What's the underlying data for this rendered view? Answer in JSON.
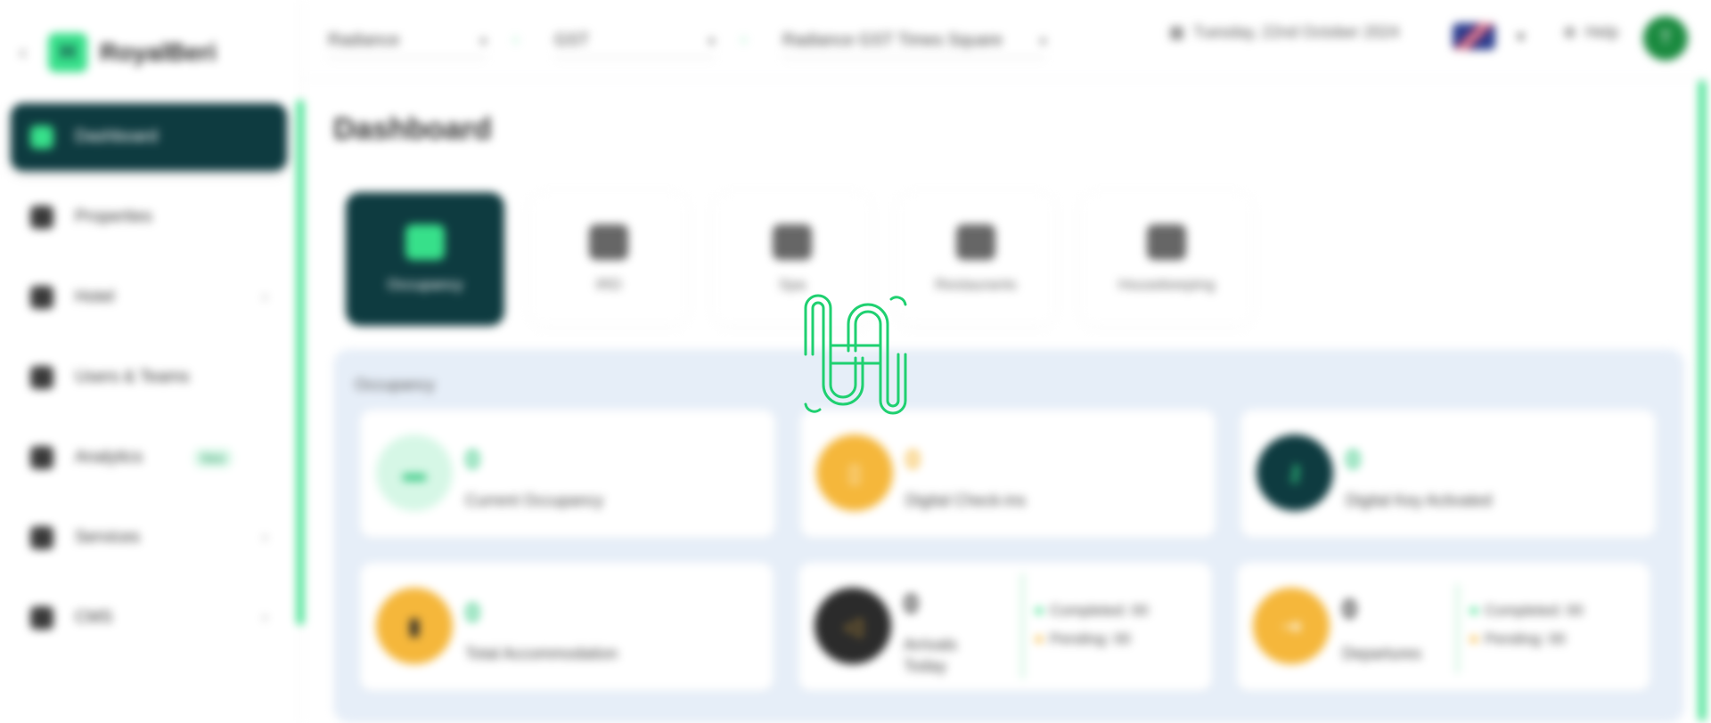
{
  "brand": {
    "name": "RoyalBeri"
  },
  "sidebar": {
    "items": [
      {
        "label": "Dashboard",
        "active": true,
        "icon": "grid-icon"
      },
      {
        "label": "Properties",
        "icon": "home-icon"
      },
      {
        "label": "Hotel",
        "icon": "hotel-icon",
        "has_chevron": true
      },
      {
        "label": "Users & Teams",
        "icon": "user-icon"
      },
      {
        "label": "Analytics",
        "icon": "chart-icon",
        "badge": "New"
      },
      {
        "label": "Services",
        "icon": "services-icon",
        "has_chevron": true
      },
      {
        "label": "CMS",
        "icon": "folder-icon",
        "has_chevron": true
      }
    ]
  },
  "header": {
    "property_select": "Radiance",
    "timezone_select": "GST",
    "hotel_select": "Radiance GST Times Square",
    "date": "Tuesday, 22nd October 2024",
    "help_label": "Help",
    "avatar_initial": "T"
  },
  "page": {
    "title": "Dashboard"
  },
  "tabs": [
    {
      "label": "Occupancy",
      "active": true,
      "icon": "bed-icon"
    },
    {
      "label": "IRD",
      "icon": "cutlery-icon"
    },
    {
      "label": "Spa",
      "icon": "spa-icon"
    },
    {
      "label": "Restaurants",
      "icon": "restaurant-icon"
    },
    {
      "label": "Housekeeping",
      "icon": "housekeeping-icon"
    }
  ],
  "panel": {
    "title": "Occupancy",
    "cards": [
      {
        "value": "0",
        "label": "Current Occupancy",
        "icon": "bed-icon",
        "icon_bg": "#d6f7e6",
        "value_color": "#37c983"
      },
      {
        "value": "0",
        "label": "Digital Check-ins",
        "icon": "phone-icon",
        "icon_bg": "#f5b73b",
        "value_color": "#f5b73b"
      },
      {
        "value": "0",
        "label": "Digital Key Activated",
        "icon": "key-icon",
        "icon_bg": "#0e3b40",
        "value_color": "#37c983"
      },
      {
        "value": "0",
        "label": "Total Accommodation",
        "icon": "door-icon",
        "icon_bg": "#f5b73b",
        "value_color": "#37c983"
      },
      {
        "value": "0",
        "label": "Arrivals Today",
        "icon": "arrival-icon",
        "icon_bg": "#2b2b2b",
        "value_color": "#2b2b2b",
        "completed": "Completed: 00",
        "pending": "Pending: 00"
      },
      {
        "value": "0",
        "label": "Departures",
        "icon": "departure-icon",
        "icon_bg": "#f5b73b",
        "value_color": "#2b2b2b",
        "completed": "Completed: 00",
        "pending": "Pending: 00"
      }
    ]
  },
  "colors": {
    "accent": "#37e08a",
    "dark": "#0e3b40",
    "amber": "#f5b73b",
    "panel": "#e6eef8"
  }
}
